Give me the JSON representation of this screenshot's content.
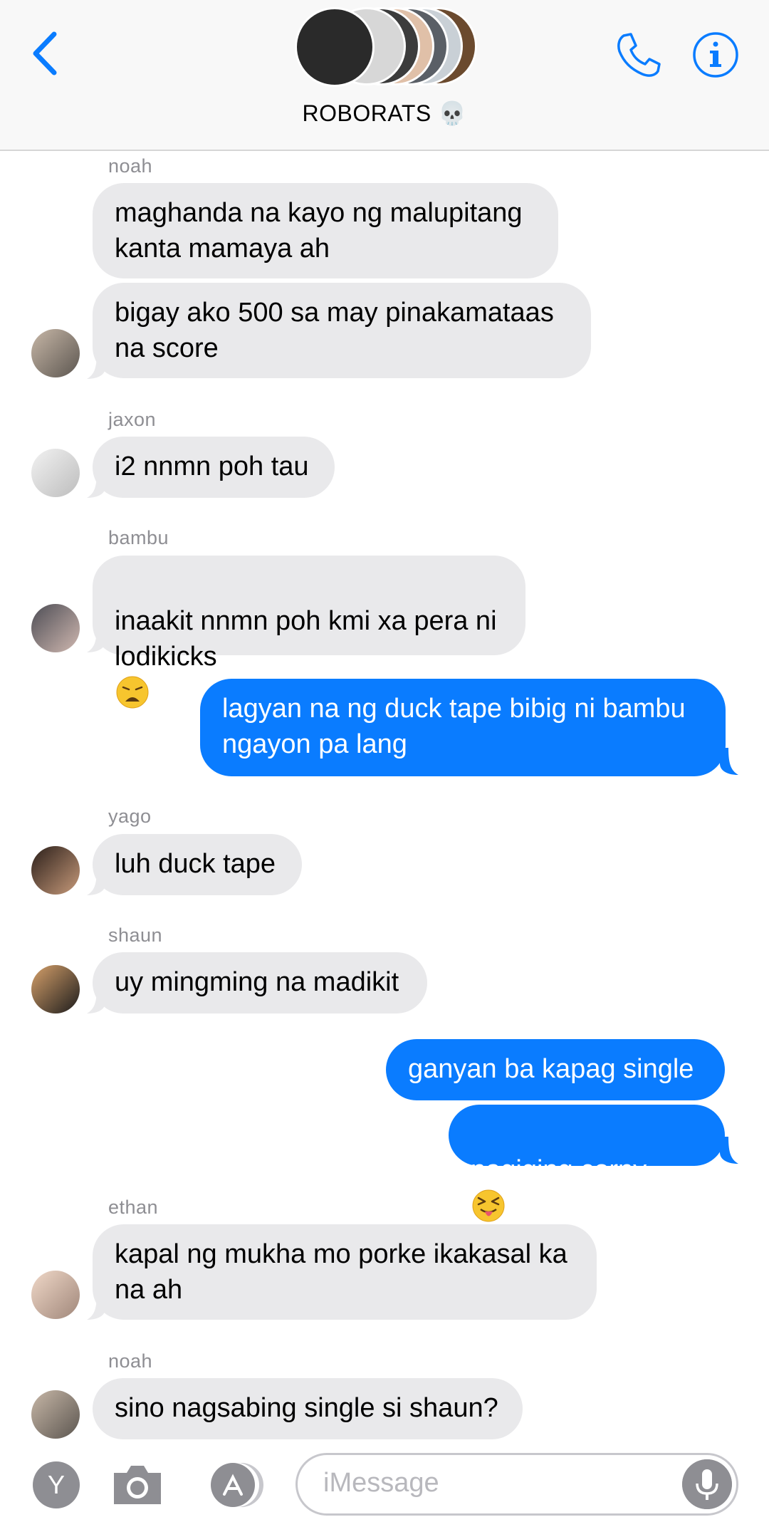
{
  "header": {
    "title": "ROBORATS 💀",
    "back_icon": "chevron-left-icon",
    "call_icon": "phone-icon",
    "info_icon": "info-icon",
    "accent_color": "#0a7cff"
  },
  "messages": [
    {
      "sender": "noah",
      "text": "maghanda na kayo ng malupitang\nkanta mamaya ah"
    },
    {
      "text": "bigay ako 500 sa may pinakamataas\nna score"
    },
    {
      "sender": "jaxon",
      "text": "i2 nnmn poh tau"
    },
    {
      "sender": "bambu",
      "text": "inaakit nnmn poh kmi xa pera ni\nlodikicks",
      "emoji": "weary-face"
    },
    {
      "text": "lagyan na ng duck tape bibig ni bambu\nngayon pa lang"
    },
    {
      "sender": "yago",
      "text": "luh duck tape"
    },
    {
      "sender": "shaun",
      "text": "uy mingming na madikit"
    },
    {
      "text": "ganyan ba kapag single"
    },
    {
      "text": "nagiging corny",
      "emoji": "squinting-tongue-face"
    },
    {
      "sender": "ethan",
      "text": "kapal ng mukha mo porke ikakasal ka\nna ah"
    },
    {
      "sender": "noah",
      "text": "sino nagsabing single si shaun?"
    }
  ],
  "composer": {
    "placeholder": "iMessage",
    "apps_button": "Y",
    "camera_icon": "camera-icon",
    "appstore_icon": "app-store-icon",
    "mic_icon": "microphone-icon"
  }
}
